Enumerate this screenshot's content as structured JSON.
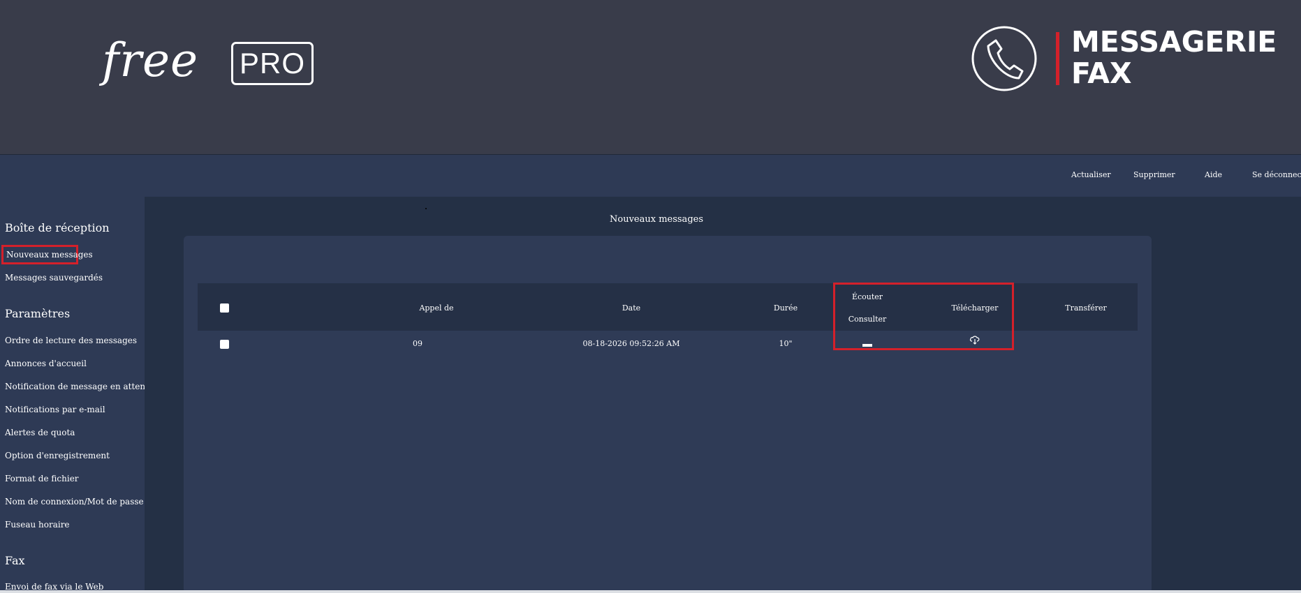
{
  "header": {
    "logo_free": "free",
    "logo_pro": "PRO",
    "brand_line1": "MESSAGERIE",
    "brand_line2": "FAX",
    "brand_accent_color": "#d4202a",
    "phone_icon": "phone-icon"
  },
  "topnav": {
    "refresh": "Actualiser",
    "delete": "Supprimer",
    "help": "Aide",
    "logout": "Se déconnecter"
  },
  "sidebar": {
    "inbox_heading": "Boîte de réception",
    "inbox_items": [
      "Nouveaux messages",
      "Messages sauvegardés"
    ],
    "settings_heading": "Paramètres",
    "settings_items": [
      "Ordre de lecture des messages",
      "Annonces d'accueil",
      "Notification de message en attente",
      "Notifications par e-mail",
      "Alertes de quota",
      "Option d'enregistrement",
      "Format de fichier",
      "Nom de connexion/Mot de passe",
      "Fuseau horaire"
    ],
    "fax_heading": "Fax",
    "fax_items": [
      "Envoi de fax via le Web"
    ]
  },
  "main": {
    "title": "Nouveaux messages",
    "table": {
      "headers": {
        "from": "Appel de",
        "date": "Date",
        "duration": "Durée",
        "listen": "Écouter",
        "view": "Consulter",
        "download": "Télécharger",
        "forward": "Transférer"
      },
      "rows": [
        {
          "from": "09",
          "date": "08-18-2026 09:52:26 AM",
          "duration": "10\"",
          "download_icon": "cloud-download-icon"
        }
      ]
    }
  }
}
